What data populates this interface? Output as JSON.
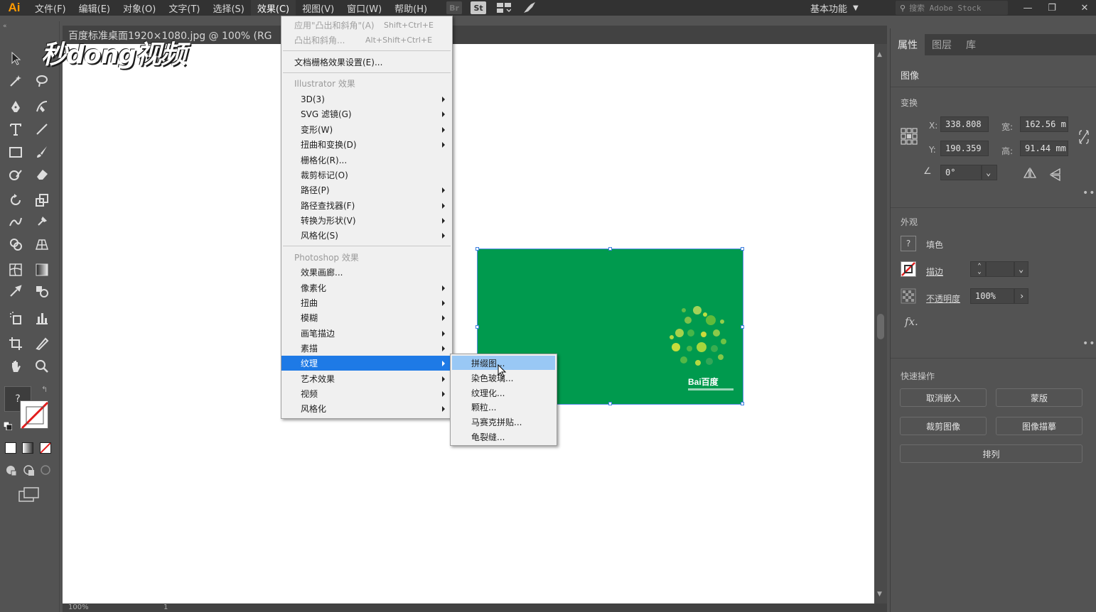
{
  "app": {
    "logo": "Ai"
  },
  "menubar": {
    "items": [
      "文件(F)",
      "编辑(E)",
      "对象(O)",
      "文字(T)",
      "选择(S)",
      "效果(C)",
      "视图(V)",
      "窗口(W)",
      "帮助(H)"
    ],
    "active_index": 5,
    "bridge_label": "Br",
    "stock_label": "St",
    "workspace": "基本功能",
    "search_placeholder": "搜索 Adobe Stock"
  },
  "document": {
    "tab_title": "百度标准桌面1920×1080.jpg @ 100% (RG"
  },
  "watermark": {
    "text": "秒dong视频"
  },
  "effect_menu": {
    "top_items": [
      {
        "label": "应用\"凸出和斜角\"(A)",
        "shortcut": "Shift+Ctrl+E",
        "disabled": true
      },
      {
        "label": "凸出和斜角...",
        "shortcut": "Alt+Shift+Ctrl+E",
        "disabled": true
      }
    ],
    "doc_raster": "文档栅格效果设置(E)...",
    "illustrator_header": "Illustrator 效果",
    "illustrator_items": [
      {
        "label": "3D(3)",
        "sub": true
      },
      {
        "label": "SVG 滤镜(G)",
        "sub": true
      },
      {
        "label": "变形(W)",
        "sub": true
      },
      {
        "label": "扭曲和变换(D)",
        "sub": true
      },
      {
        "label": "栅格化(R)...",
        "sub": false
      },
      {
        "label": "裁剪标记(O)",
        "sub": false
      },
      {
        "label": "路径(P)",
        "sub": true
      },
      {
        "label": "路径查找器(F)",
        "sub": true
      },
      {
        "label": "转换为形状(V)",
        "sub": true
      },
      {
        "label": "风格化(S)",
        "sub": true
      }
    ],
    "photoshop_header": "Photoshop 效果",
    "photoshop_items": [
      {
        "label": "效果画廊...",
        "sub": false
      },
      {
        "label": "像素化",
        "sub": true
      },
      {
        "label": "扭曲",
        "sub": true
      },
      {
        "label": "模糊",
        "sub": true
      },
      {
        "label": "画笔描边",
        "sub": true
      },
      {
        "label": "素描",
        "sub": true
      },
      {
        "label": "纹理",
        "sub": true,
        "highlighted": true
      },
      {
        "label": "艺术效果",
        "sub": true
      },
      {
        "label": "视频",
        "sub": true
      },
      {
        "label": "风格化",
        "sub": true
      }
    ]
  },
  "texture_submenu": {
    "items": [
      "拼缀图...",
      "染色玻璃...",
      "纹理化...",
      "颗粒...",
      "马赛克拼贴...",
      "龟裂缝..."
    ],
    "highlighted_index": 0
  },
  "artwork": {
    "fill_color": "#009a4e",
    "brand_text": "Bai百度"
  },
  "panel": {
    "tabs": [
      "属性",
      "图层",
      "库"
    ],
    "active_tab": 0,
    "object_type": "图像",
    "transform_title": "变换",
    "x_label": "X:",
    "x_value": "338.808",
    "y_label": "Y:",
    "y_value": "190.359",
    "w_label": "宽:",
    "w_value": "162.56 m",
    "h_label": "高:",
    "h_value": "91.44 mm",
    "angle_value": "0°",
    "appearance_title": "外观",
    "fill_label": "填色",
    "stroke_label": "描边",
    "opacity_label": "不透明度",
    "opacity_value": "100%",
    "fx_label": "fx.",
    "quick_title": "快速操作",
    "buttons": [
      "取消嵌入",
      "蒙版",
      "裁剪图像",
      "图像描摹",
      "排列"
    ]
  },
  "status": {
    "zoom": "100%",
    "page": "1"
  }
}
